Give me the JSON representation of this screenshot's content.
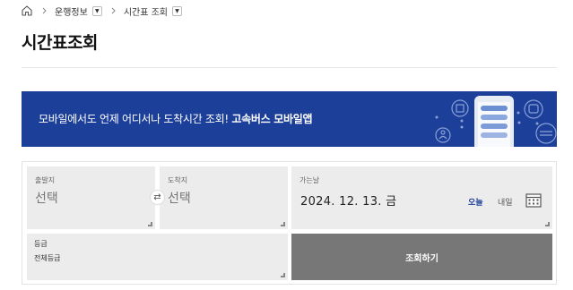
{
  "breadcrumb": {
    "items": [
      {
        "label": "운행정보"
      },
      {
        "label": "시간표 조회"
      }
    ]
  },
  "page": {
    "title": "시간표조회"
  },
  "banner": {
    "text_normal": "모바일에서도 언제 어디서나 도착시간 조회! ",
    "text_bold": "고속버스 모바일앱"
  },
  "form": {
    "departure": {
      "label": "출발지",
      "value": "선택"
    },
    "arrival": {
      "label": "도착지",
      "value": "선택"
    },
    "swap_icon": "⇄",
    "date": {
      "label": "가는날",
      "value": "2024. 12. 13. 금",
      "today_label": "오늘",
      "tomorrow_label": "내일"
    },
    "grade": {
      "label": "등급",
      "value": "전체등급"
    },
    "search_label": "조회하기"
  },
  "colors": {
    "banner_bg": "#1c3f99",
    "search_button_bg": "#777777",
    "field_bg": "#ececec",
    "accent": "#1c3f99"
  },
  "icons": [
    "home-icon",
    "chevron-right-icon",
    "chevron-down-icon",
    "swap-icon",
    "calendar-icon"
  ]
}
